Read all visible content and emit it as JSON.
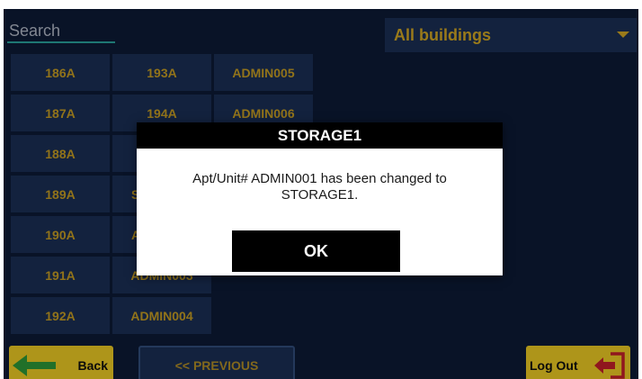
{
  "search": {
    "placeholder": "Search"
  },
  "building_filter": {
    "selected": "All buildings",
    "icon": "chevron-down-icon"
  },
  "units": {
    "col1": [
      "186A",
      "187A",
      "188A",
      "189A",
      "190A",
      "191A",
      "192A"
    ],
    "col2": [
      "193A",
      "194A",
      "",
      "S",
      "A",
      "ADMIN003",
      "ADMIN004"
    ],
    "col3": [
      "ADMIN005",
      "ADMIN006"
    ]
  },
  "nav": {
    "back_label": "Back",
    "back_icon": "arrow-left-icon",
    "previous_label": "<< PREVIOUS",
    "logout_label": "Log Out",
    "logout_icon": "logout-icon"
  },
  "dialog": {
    "title": "STORAGE1",
    "message": "Apt/Unit# ADMIN001 has been changed to STORAGE1.",
    "ok_label": "OK"
  },
  "colors": {
    "background": "#0d1b36",
    "tile": "#1b3057",
    "accent_gold": "#c9a024",
    "button_yellow": "#f2cf24",
    "icon_green": "#2f9b3a",
    "icon_red": "#c8202a"
  }
}
